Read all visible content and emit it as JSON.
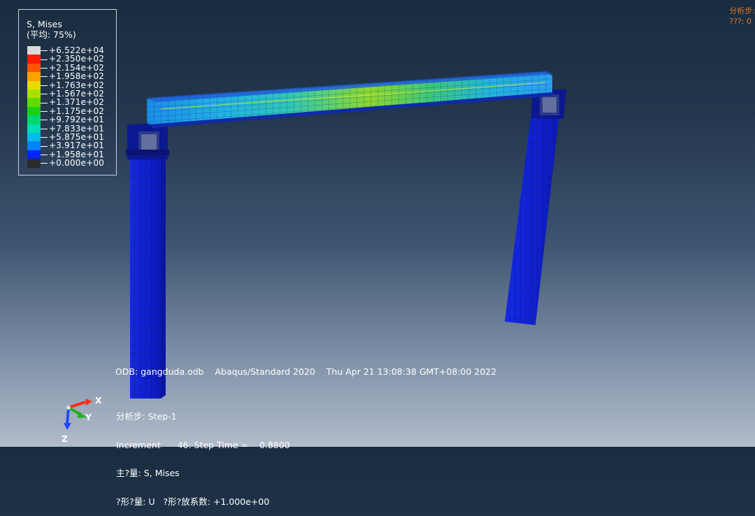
{
  "legend": {
    "title": "S, Mises",
    "subtitle": "(平均: 75%)",
    "entries": [
      {
        "value": "+6.522e+04",
        "color": "#d9d9d9"
      },
      {
        "value": "+2.350e+02",
        "color": "#ff1a00"
      },
      {
        "value": "+2.154e+02",
        "color": "#ff5500"
      },
      {
        "value": "+1.958e+02",
        "color": "#ff9f00"
      },
      {
        "value": "+1.763e+02",
        "color": "#e6dc00"
      },
      {
        "value": "+1.567e+02",
        "color": "#a8e000"
      },
      {
        "value": "+1.371e+02",
        "color": "#5fdc00"
      },
      {
        "value": "+1.175e+02",
        "color": "#1cd018"
      },
      {
        "value": "+9.792e+01",
        "color": "#00d76e"
      },
      {
        "value": "+7.833e+01",
        "color": "#00dcb4"
      },
      {
        "value": "+5.875e+01",
        "color": "#00bde6"
      },
      {
        "value": "+3.917e+01",
        "color": "#0081ff"
      },
      {
        "value": "+1.958e+01",
        "color": "#0023ff"
      },
      {
        "value": "+0.000e+00",
        "color": "#2b2b2b"
      }
    ]
  },
  "top_right": {
    "line1": "分析步:",
    "line2": "???: 0"
  },
  "odb_line": "ODB: gangduda.odb    Abaqus/Standard 2020    Thu Apr 21 13:08:38 GMT+08:00 2022",
  "step_info": {
    "line1": "分析步: Step-1",
    "line2": "Increment      46: Step Time =    0.8800",
    "line3": "主?量: S, Mises",
    "line4": "?形?量: U   ?形?放系数: +1.000e+00"
  },
  "triad": {
    "x_label": "X",
    "y_label": "Y",
    "z_label": "Z"
  },
  "colors": {
    "element_blue": "#0f1fd6",
    "mesh_line": "#0a1466",
    "legend_border": "#c8d0da",
    "top_right_text": "#e6781e"
  }
}
